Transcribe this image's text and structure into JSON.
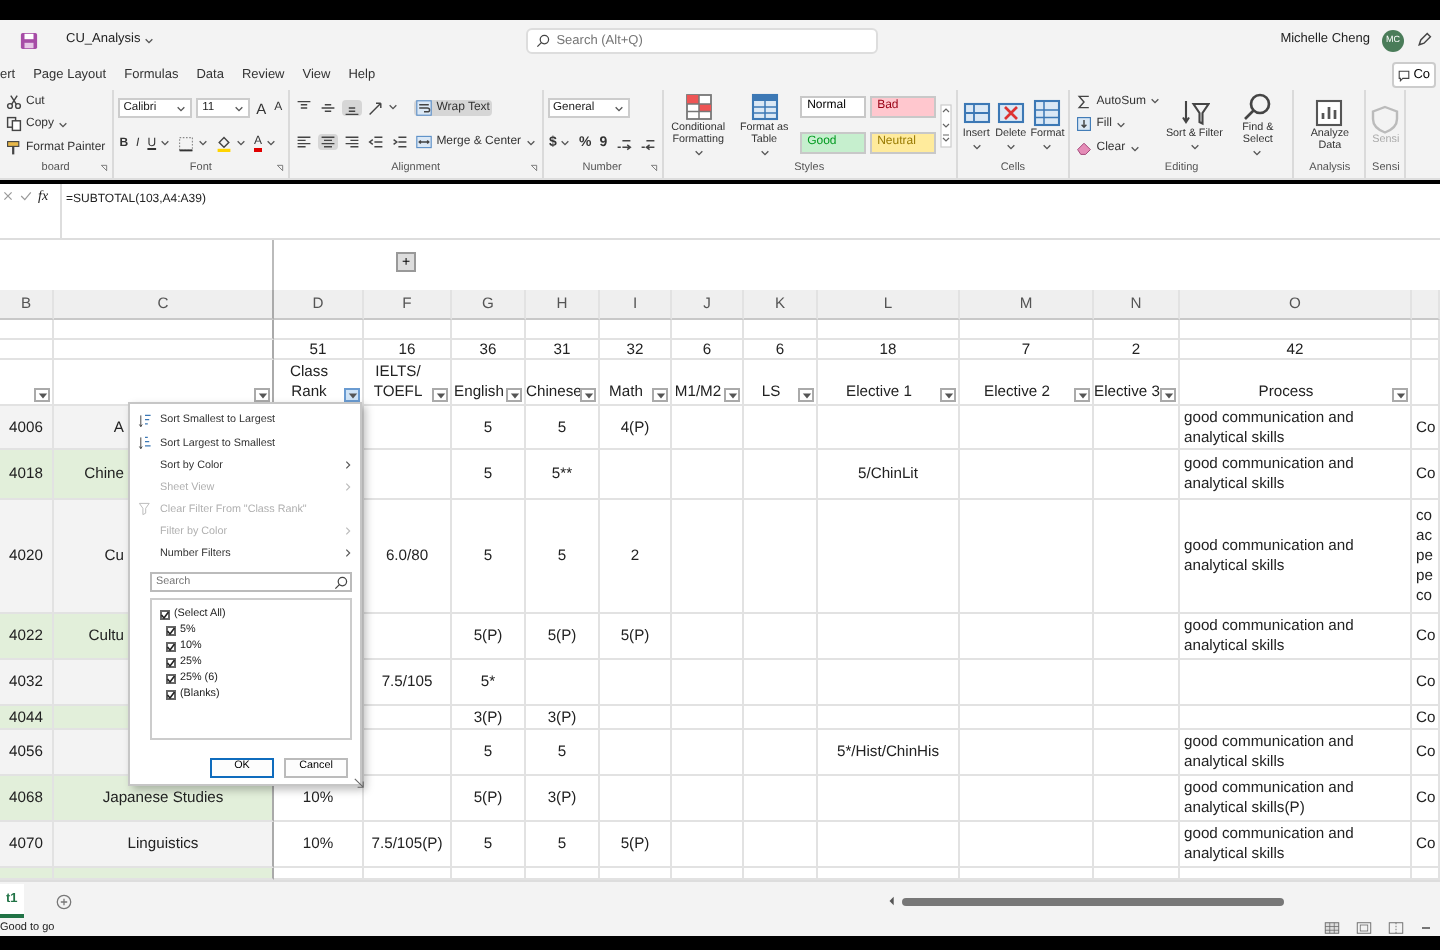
{
  "title_bar": {
    "file_name": "CU_Analysis",
    "search_placeholder": "Search (Alt+Q)",
    "user_name": "Michelle Cheng",
    "user_initials": "MC"
  },
  "menu_tabs": [
    {
      "label": "ert",
      "selected": false
    },
    {
      "label": "Page Layout",
      "selected": false
    },
    {
      "label": "Formulas",
      "selected": false
    },
    {
      "label": "Data",
      "selected": false
    },
    {
      "label": "Review",
      "selected": false
    },
    {
      "label": "View",
      "selected": false
    },
    {
      "label": "Help",
      "selected": false
    }
  ],
  "comments_button": "Co",
  "ribbon": [
    {
      "label": "board",
      "launcher": true,
      "columns": [
        [
          [
            {
              "kind": "cut",
              "label": "Cut"
            }
          ],
          [
            {
              "kind": "copy",
              "label": "Copy",
              "dropdown": true
            }
          ],
          [
            {
              "kind": "painter",
              "label": "Format Painter"
            }
          ]
        ]
      ]
    },
    {
      "label": "Font",
      "launcher": true,
      "columns": [
        [
          [
            {
              "kind": "select",
              "value": "Calibri"
            },
            {
              "kind": "select",
              "value": "11"
            },
            {
              "kind": "grow",
              "label": "A"
            },
            {
              "kind": "shrink",
              "label": "A"
            }
          ],
          [
            {
              "kind": "bold",
              "label": "B"
            },
            {
              "kind": "italic",
              "label": "I"
            },
            {
              "kind": "underline",
              "label": "U",
              "dropdown": true
            },
            {
              "kind": "borders",
              "dropdown": true
            },
            {
              "kind": "fill_color",
              "dropdown": true
            },
            {
              "kind": "font_color",
              "label": "A",
              "dropdown": true
            }
          ]
        ]
      ]
    },
    {
      "label": "Alignment",
      "launcher": true,
      "columns": [
        [
          [
            {
              "kind": "align_top",
              "on": false
            },
            {
              "kind": "align_middle",
              "on": false
            },
            {
              "kind": "align_bottom",
              "on": true
            },
            {
              "kind": "orientation",
              "on": false,
              "dropdown": true
            }
          ],
          [
            {
              "kind": "align_left",
              "on": false
            },
            {
              "kind": "align_center",
              "on": true
            },
            {
              "kind": "align_right",
              "on": false
            },
            {
              "kind": "outdent",
              "on": false
            },
            {
              "kind": "indent",
              "on": false
            }
          ]
        ],
        [
          [
            {
              "kind": "wrap",
              "label": "Wrap Text",
              "on": true
            }
          ],
          [
            {
              "kind": "merge",
              "label": "Merge & Center",
              "on": false,
              "dropdown": true
            }
          ]
        ]
      ]
    },
    {
      "label": "Number",
      "launcher": true,
      "columns": [
        [
          [
            {
              "kind": "select",
              "value": "General"
            }
          ],
          [
            {
              "kind": "text",
              "label": "$",
              "dropdown": true
            },
            {
              "kind": "text",
              "label": "%"
            },
            {
              "kind": "text",
              "label": "9"
            },
            {
              "kind": "inc_decimal"
            },
            {
              "kind": "dec_decimal"
            }
          ]
        ]
      ]
    },
    {
      "label": "Styles",
      "launcher": false,
      "columns": [
        [
          [
            {
              "kind": "conditional",
              "label": "Conditional Formatting",
              "large": true,
              "dropdown": true
            }
          ]
        ],
        [
          [
            {
              "kind": "table",
              "label": "Format as Table",
              "large": true,
              "dropdown": true
            }
          ]
        ],
        [
          [
            {
              "kind": "style",
              "label": "Normal",
              "color": "#ffffff"
            },
            {
              "kind": "style",
              "label": "Bad",
              "color": "#ffc7ce"
            }
          ],
          [
            {
              "kind": "style",
              "label": "Good",
              "color": "#c6efce"
            },
            {
              "kind": "style",
              "label": "Neutral",
              "color": "#ffeb9c"
            }
          ]
        ],
        [
          [
            {
              "kind": "gallery_scroll"
            }
          ]
        ]
      ]
    },
    {
      "label": "Cells",
      "launcher": false,
      "columns": [
        [
          [
            {
              "kind": "insert",
              "label": "Insert",
              "large": true,
              "dropdown": true
            }
          ]
        ],
        [
          [
            {
              "kind": "delete",
              "label": "Delete",
              "large": true,
              "dropdown": true
            }
          ]
        ],
        [
          [
            {
              "kind": "format",
              "label": "Format",
              "large": true,
              "dropdown": true
            }
          ]
        ]
      ]
    },
    {
      "label": "Editing",
      "launcher": false,
      "columns": [
        [
          [
            {
              "kind": "autosum",
              "label": "AutoSum",
              "dropdown": true
            }
          ],
          [
            {
              "kind": "fill",
              "label": "Fill",
              "dropdown": true
            }
          ],
          [
            {
              "kind": "clear",
              "label": "Clear",
              "dropdown": true
            }
          ]
        ],
        [
          [
            {
              "kind": "sort",
              "label": "Sort & Filter",
              "large": true,
              "dropdown": true
            }
          ]
        ],
        [
          [
            {
              "kind": "find",
              "label": "Find & Select",
              "large": true,
              "dropdown": true
            }
          ]
        ]
      ]
    },
    {
      "label": "Analysis",
      "launcher": false,
      "columns": [
        [
          [
            {
              "kind": "analyze",
              "label": "Analyze Data",
              "large": true
            }
          ]
        ]
      ]
    },
    {
      "label": "Sensi",
      "launcher": false,
      "columns": [
        [
          [
            {
              "kind": "sensitivity",
              "label": "Sensi",
              "large": true,
              "disabled": true
            }
          ]
        ]
      ]
    }
  ],
  "formula_bar": {
    "function_label": "fx",
    "formula": "=SUBTOTAL(103,A4:A39)"
  },
  "outline_button": "+",
  "columns": [
    {
      "letter": "B",
      "filter": true,
      "filter_open": false
    },
    {
      "letter": "C",
      "filter": true,
      "filter_open": false
    },
    {
      "letter": "D",
      "count": "51",
      "title": "Class Rank",
      "filter": true,
      "filter_open": true
    },
    {
      "letter": "F",
      "count": "16",
      "title": "IELTS/ TOEFL",
      "filter": true,
      "filter_open": false
    },
    {
      "letter": "G",
      "count": "36",
      "title": "English",
      "filter": true,
      "filter_open": false
    },
    {
      "letter": "H",
      "count": "31",
      "title": "Chinese",
      "filter": true,
      "filter_open": false
    },
    {
      "letter": "I",
      "count": "32",
      "title": "Math",
      "filter": true,
      "filter_open": false
    },
    {
      "letter": "J",
      "count": "6",
      "title": "M1/M2",
      "filter": true,
      "filter_open": false
    },
    {
      "letter": "K",
      "count": "6",
      "title": "LS",
      "filter": true,
      "filter_open": false
    },
    {
      "letter": "L",
      "count": "18",
      "title": "Elective 1",
      "filter": true,
      "filter_open": false
    },
    {
      "letter": "M",
      "count": "7",
      "title": "Elective 2",
      "filter": true,
      "filter_open": false
    },
    {
      "letter": "N",
      "count": "2",
      "title": "Elective 3",
      "filter": true,
      "filter_open": false
    },
    {
      "letter": "O",
      "count": "42",
      "title": "Process",
      "filter": true,
      "filter_open": false
    },
    {
      "filter": false
    }
  ],
  "rows": [
    {
      "highlighted": false,
      "cells": {
        "B": "4006",
        "C": "A",
        "G": "5",
        "H": "5",
        "I": "4(P)",
        "O": "good communication and analytical skills",
        "cut": "Co"
      }
    },
    {
      "highlighted": true,
      "cells": {
        "B": "4018",
        "C": "Chine",
        "G": "5",
        "H": "5**",
        "L": "5/ChinLit",
        "O": "good communication and analytical skills",
        "cut": "Co"
      }
    },
    {
      "highlighted": false,
      "cells": {
        "B": "4020",
        "C": "Cu",
        "F": "6.0/80",
        "G": "5",
        "H": "5",
        "I": "2",
        "O": "good communication and analytical skills",
        "cut": "co ac pe pe co"
      }
    },
    {
      "highlighted": true,
      "cells": {
        "B": "4022",
        "C": "Cultu",
        "G": "5(P)",
        "H": "5(P)",
        "I": "5(P)",
        "O": "good communication and analytical skills",
        "cut": "Co"
      }
    },
    {
      "highlighted": false,
      "cells": {
        "B": "4032",
        "F": "7.5/105",
        "G": "5*",
        "cut": "Co"
      }
    },
    {
      "highlighted": true,
      "cells": {
        "B": "4044",
        "G": "3(P)",
        "H": "3(P)",
        "cut": "Co"
      }
    },
    {
      "highlighted": false,
      "cells": {
        "B": "4056",
        "G": "5",
        "H": "5",
        "L": "5*/Hist/ChinHis",
        "O": "good communication and analytical skills",
        "cut": "Co"
      }
    },
    {
      "highlighted": true,
      "cells": {
        "B": "4068",
        "C": "Japanese Studies",
        "D": "10%",
        "G": "5(P)",
        "H": "3(P)",
        "O": "good communication and analytical skills(P)",
        "cut": "Co"
      }
    },
    {
      "highlighted": false,
      "cells": {
        "B": "4070",
        "C": "Linguistics",
        "D": "10%",
        "F": "7.5/105(P)",
        "G": "5",
        "H": "5",
        "I": "5(P)",
        "O": "good communication and analytical skills",
        "cut": "Co"
      }
    }
  ],
  "filter_menu": {
    "items": [
      {
        "kind": "sort_asc",
        "label": "Sort Smallest to Largest",
        "disabled": false,
        "submenu": false
      },
      {
        "kind": "sort_desc",
        "label": "Sort Largest to Smallest",
        "disabled": false,
        "submenu": false
      },
      {
        "kind": "plain",
        "label": "Sort by Color",
        "disabled": false,
        "submenu": true
      },
      {
        "kind": "plain",
        "label": "Sheet View",
        "disabled": true,
        "submenu": true
      },
      {
        "kind": "clear_filter",
        "label": "Clear Filter From \"Class Rank\"",
        "disabled": true,
        "submenu": false
      },
      {
        "kind": "plain",
        "label": "Filter by Color",
        "disabled": true,
        "submenu": true
      },
      {
        "kind": "plain",
        "label": "Number Filters",
        "disabled": false,
        "submenu": true
      }
    ],
    "search_placeholder": "Search",
    "values": [
      {
        "label": "(Select All)",
        "checked": true
      },
      {
        "label": "5%",
        "checked": true
      },
      {
        "label": "10%",
        "checked": true
      },
      {
        "label": "25%",
        "checked": true
      },
      {
        "label": "25% (6)",
        "checked": true
      },
      {
        "label": "(Blanks)",
        "checked": true
      }
    ],
    "buttons": [
      "OK",
      "Cancel"
    ]
  },
  "sheet_tabs": [
    {
      "label": "t1",
      "selected": true
    }
  ],
  "status_bar": {
    "text": "Good to go"
  }
}
